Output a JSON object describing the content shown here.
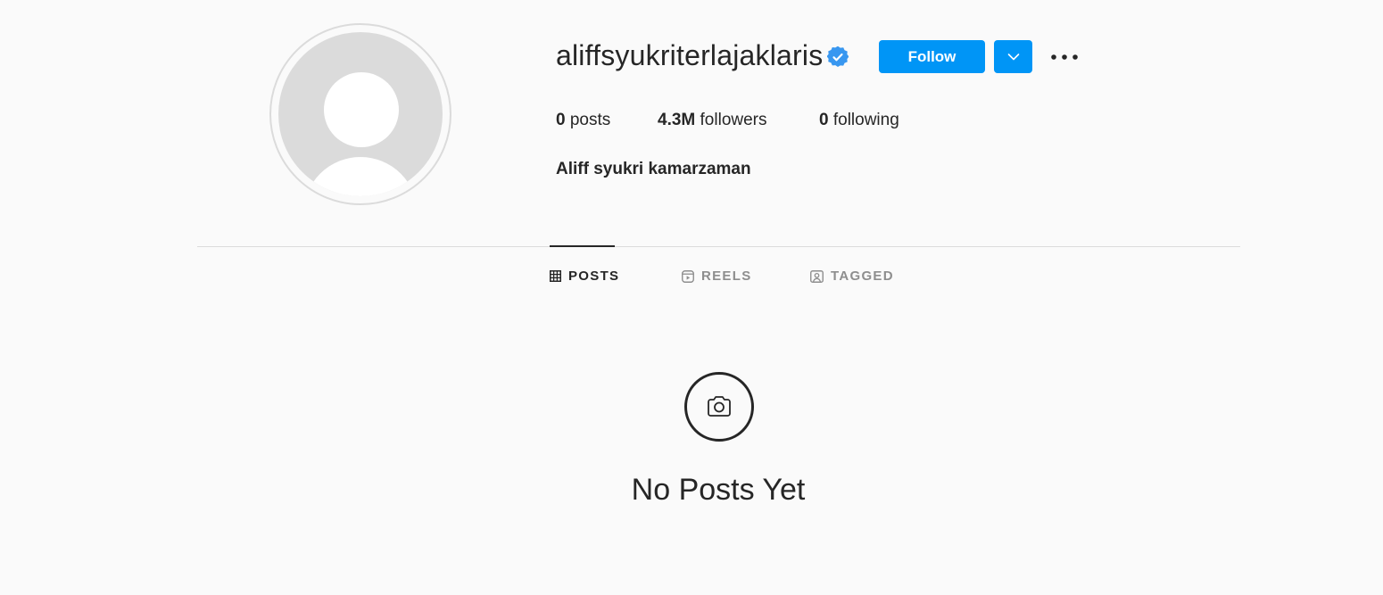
{
  "profile": {
    "username": "aliffsyukriterlajaklaris",
    "verified": true,
    "full_name": "Aliff syukri kamarzaman",
    "follow_label": "Follow"
  },
  "stats": {
    "posts_count": "0",
    "posts_label": "posts",
    "followers_count": "4.3M",
    "followers_label": "followers",
    "following_count": "0",
    "following_label": "following"
  },
  "tabs": [
    {
      "label": "POSTS",
      "icon": "grid-icon",
      "active": true
    },
    {
      "label": "REELS",
      "icon": "reels-icon",
      "active": false
    },
    {
      "label": "TAGGED",
      "icon": "tagged-icon",
      "active": false
    }
  ],
  "empty_state": {
    "icon": "camera-icon",
    "text": "No Posts Yet"
  },
  "colors": {
    "accent": "#0095f6",
    "verified": "#3897f0",
    "background": "#fafafa",
    "text": "#262626",
    "muted": "#8e8e8e",
    "divider": "#dbdbdb"
  }
}
